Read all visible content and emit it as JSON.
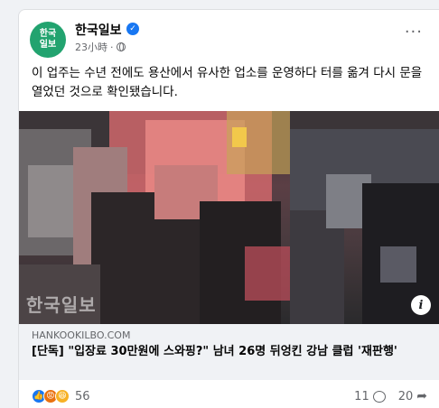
{
  "post": {
    "avatar_text": "한국\n일보",
    "page_name": "한국일보",
    "time": "23小時",
    "separator": "·",
    "text": "이 업주는 수년 전에도 용산에서 유사한 업소를 운영하다 터를 옮겨 다시 문을 열었던 것으로 확인됐습니다.",
    "more_label": "···",
    "verified_glyph": "✓"
  },
  "media": {
    "watermark": "한국일보",
    "info_glyph": "i"
  },
  "link": {
    "domain": "HANKOOKILBO.COM",
    "headline": "[단독] \"입장료 30만원에 스와핑?\" 남녀 26명 뒤엉킨 강남 클럽 '재판행'"
  },
  "footer": {
    "reaction_count": "56",
    "comment_count": "11",
    "share_count": "20"
  },
  "colors": {
    "accent": "#1877f2",
    "avatar_bg": "#22a36f",
    "muted": "#65676b"
  },
  "icons": [
    "verified-badge-icon",
    "globe-icon",
    "more-options-icon",
    "info-icon",
    "like-reaction-icon",
    "angry-reaction-icon",
    "haha-reaction-icon",
    "comment-icon",
    "share-icon"
  ]
}
